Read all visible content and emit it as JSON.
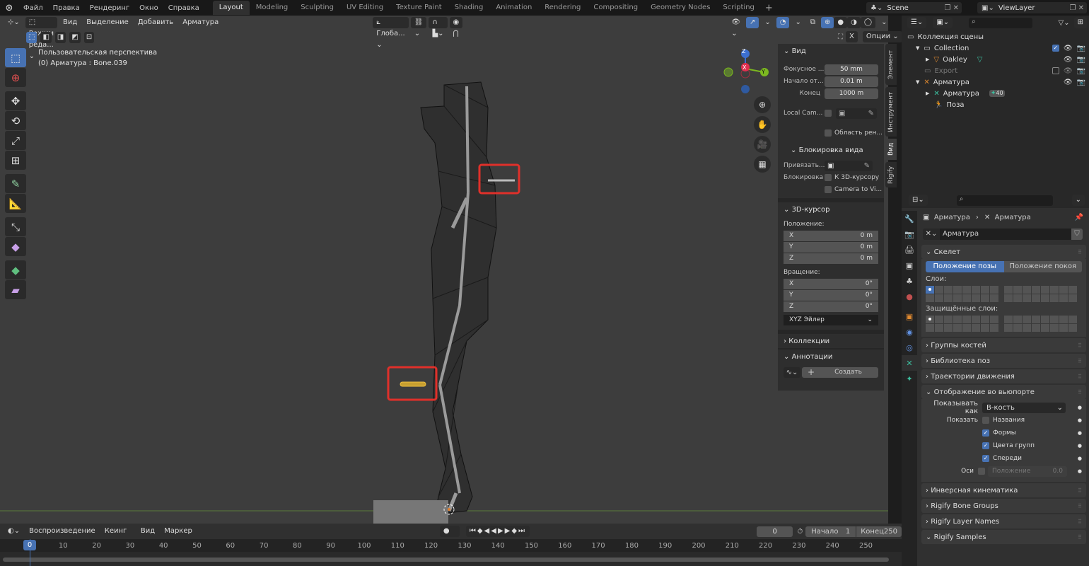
{
  "topbar": {
    "menus": [
      "Файл",
      "Правка",
      "Рендеринг",
      "Окно",
      "Справка"
    ],
    "workspaces": [
      "Layout",
      "Modeling",
      "Sculpting",
      "UV Editing",
      "Texture Paint",
      "Shading",
      "Animation",
      "Rendering",
      "Compositing",
      "Geometry Nodes",
      "Scripting"
    ],
    "active_workspace": "Layout",
    "scene": "Scene",
    "view_layer": "ViewLayer"
  },
  "viewport_header": {
    "mode": "Режим реда...",
    "menus": [
      "Вид",
      "Выделение",
      "Добавить",
      "Арматура"
    ],
    "orientation": "Глоба...",
    "options": "Опции",
    "x_label": "X"
  },
  "viewport": {
    "view_name": "Пользовательская перспектива",
    "active_info": "(0) Арматура : Bone.039",
    "gizmo": {
      "x": "X",
      "y": "Y",
      "z": "Z"
    }
  },
  "npanel": {
    "tabs": [
      "Элемент",
      "Инструмент",
      "Вид",
      "Rigify"
    ],
    "active_tab": "Вид",
    "view_section": "Вид",
    "focal_label": "Фокусное ...",
    "focal_value": "50 mm",
    "clip_start_label": "Начало от...",
    "clip_start_value": "0.01 m",
    "clip_end_label": "Конец",
    "clip_end_value": "1000 m",
    "local_camera_label": "Local Cam...",
    "render_region_label": "Область рен...",
    "view_lock_section": "Блокировка вида",
    "lock_to_label": "Привязать...",
    "lock_label": "Блокировка",
    "lock_cursor_label": "К 3D-курсору",
    "camera_to_view_label": "Camera to Vi...",
    "cursor_section": "3D-курсор",
    "location_label": "Положение:",
    "location": [
      {
        "axis": "X",
        "value": "0 m"
      },
      {
        "axis": "Y",
        "value": "0 m"
      },
      {
        "axis": "Z",
        "value": "0 m"
      }
    ],
    "rotation_label": "Вращение:",
    "rotation": [
      {
        "axis": "X",
        "value": "0°"
      },
      {
        "axis": "Y",
        "value": "0°"
      },
      {
        "axis": "Z",
        "value": "0°"
      }
    ],
    "rotation_mode": "XYZ Эйлер",
    "collections_section": "Коллекции",
    "annotations_section": "Аннотации",
    "create_label": "Создать"
  },
  "outliner": {
    "root": "Коллекция сцены",
    "items": [
      {
        "name": "Collection",
        "level": 1
      },
      {
        "name": "Oakley",
        "level": 2
      },
      {
        "name": "Export",
        "level": 1
      },
      {
        "name": "Арматура",
        "level": 1
      },
      {
        "name": "Арматура",
        "level": 2,
        "badge": "40"
      },
      {
        "name": "Поза",
        "level": 2
      }
    ]
  },
  "properties": {
    "breadcrumb_object": "Арматура",
    "breadcrumb_data": "Арматура",
    "data_name": "Арматура",
    "skeleton_section": "Скелет",
    "pose_position": "Положение позы",
    "rest_position": "Положение покоя",
    "layers_label": "Слои:",
    "protected_layers_label": "Защищённые слои:",
    "bone_groups": "Группы костей",
    "pose_library": "Библиотека поз",
    "motion_paths": "Траектории движения",
    "viewport_display": "Отображение во вьюпорте",
    "display_as_label": "Показывать как",
    "display_as_value": "B-кость",
    "show_label": "Показать",
    "names_label": "Названия",
    "shapes_label": "Формы",
    "group_colors_label": "Цвета групп",
    "in_front_label": "Спереди",
    "axes_label": "Оси",
    "position_label": "Положение",
    "position_value": "0.0",
    "ik_section": "Инверсная кинематика",
    "rigify_bone_groups": "Rigify Bone Groups",
    "rigify_layer_names": "Rigify Layer Names",
    "rigify_samples": "Rigify Samples"
  },
  "timeline": {
    "playback": "Воспроизведение",
    "keying": "Кеинг",
    "view": "Вид",
    "marker": "Маркер",
    "current_frame": "0",
    "start_label": "Начало",
    "start_value": "1",
    "end_label": "Конец",
    "end_value": "250",
    "ticks": [
      "0",
      "10",
      "20",
      "30",
      "40",
      "50",
      "60",
      "70",
      "80",
      "90",
      "100",
      "110",
      "120",
      "130",
      "140",
      "150",
      "160",
      "170",
      "180",
      "190",
      "200",
      "210",
      "220",
      "230",
      "240",
      "250"
    ]
  }
}
